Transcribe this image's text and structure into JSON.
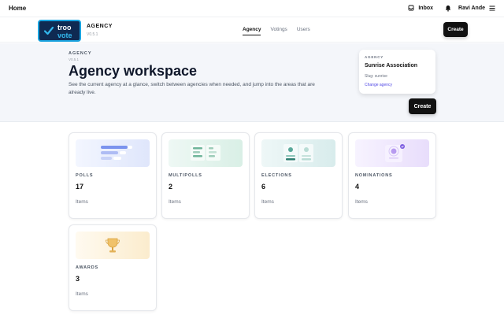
{
  "topbar": {
    "home": "Home",
    "inbox": "Inbox",
    "user": "Ravi Ande",
    "icons": {
      "inbox": "inbox-icon",
      "bell": "bell-icon",
      "menu": "menu-icon"
    }
  },
  "agency_header": {
    "logo": {
      "line1": "troo",
      "line2": "vote"
    },
    "name": "AGENCY",
    "version": "V0.5.1",
    "tabs": [
      {
        "label": "Agency",
        "active": true
      },
      {
        "label": "Votings",
        "active": false
      },
      {
        "label": "Users",
        "active": false
      }
    ],
    "create_label": "Create"
  },
  "hero": {
    "eyebrow": "AGENCY",
    "version": "V0.5.1",
    "title": "Agency workspace",
    "description": "See the current agency at a glance, switch between agencies when needed, and jump into the areas that are already live.",
    "create_label": "Create"
  },
  "current_agency": {
    "eyebrow": "AGENCY",
    "name": "Sunrise Association",
    "slug": "Slug: sunrise",
    "change_link": "Change agency"
  },
  "cards": [
    {
      "label": "POLLS",
      "count": "17",
      "items": "Items"
    },
    {
      "label": "MULTIPOLLS",
      "count": "2",
      "items": "Items"
    },
    {
      "label": "ELECTIONS",
      "count": "6",
      "items": "Items"
    },
    {
      "label": "NOMINATIONS",
      "count": "4",
      "items": "Items"
    },
    {
      "label": "AWARDS",
      "count": "3",
      "items": "Items"
    }
  ],
  "colors": {
    "primary": "#111111",
    "accent_link": "#4f46e5",
    "logo_bg": "#0f2a52",
    "logo_accent": "#1aa4e0"
  }
}
